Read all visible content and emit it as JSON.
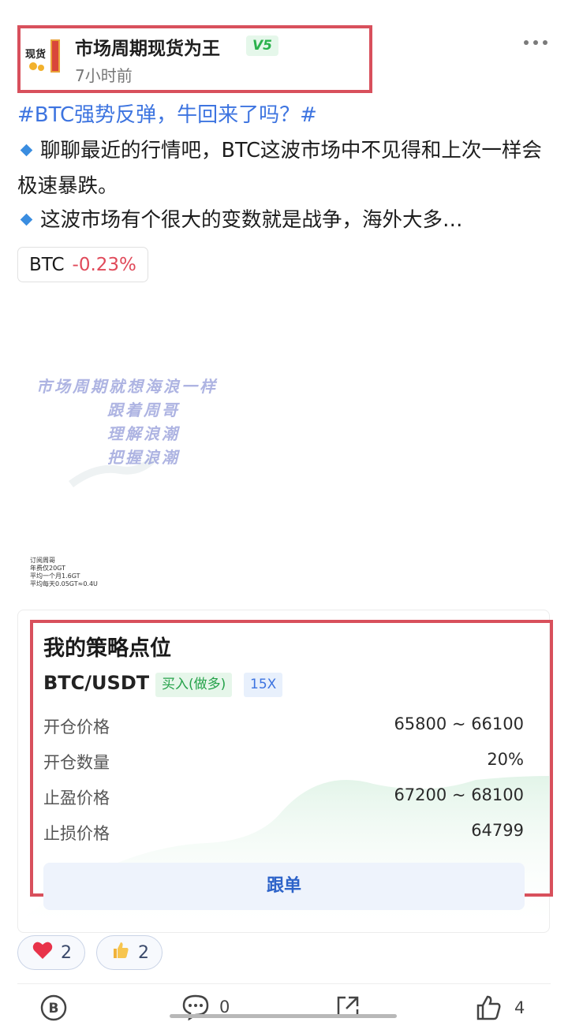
{
  "post": {
    "author": "市场周期现货为王",
    "level": "V5",
    "time": "7小时前",
    "avatar_text": "现货",
    "hashtag": "#BTC强势反弹，牛回来了吗？#",
    "para1": "聊聊最近的行情吧，BTC这波市场中不见得和上次一样会极速暴跌。",
    "para2": "这波市场有个很大的变数就是战争，海外大多…",
    "ticker": {
      "symbol": "BTC",
      "change": "-0.23%"
    }
  },
  "image": {
    "watermark_lines": [
      "市场周期就想海浪一样",
      "跟着周哥",
      "理解浪潮",
      "把握浪潮"
    ],
    "small_lines": [
      "订阅周哥",
      "年费仅20GT",
      "平均一个月1.6GT",
      "平均每天0.05GT≈0.4U"
    ]
  },
  "strategy": {
    "title": "我的策略点位",
    "pair": "BTC/USDT",
    "side": "买入(做多)",
    "leverage": "15X",
    "rows": [
      {
        "label": "开仓价格",
        "value": "65800 ~ 66100"
      },
      {
        "label": "开仓数量",
        "value": "20%"
      },
      {
        "label": "止盈价格",
        "value": "67200 ~ 68100"
      },
      {
        "label": "止损价格",
        "value": "64799"
      }
    ],
    "button": "跟单"
  },
  "reactions": [
    {
      "icon": "heart-icon",
      "count": "2"
    },
    {
      "icon": "thumbs-up-icon",
      "count": "2"
    }
  ],
  "actions": {
    "comments": "0",
    "likes": "4"
  },
  "colors": {
    "highlight_box": "#d8505c",
    "link": "#3d74e0",
    "negative": "#e04a5a",
    "positive": "#25a24a"
  }
}
